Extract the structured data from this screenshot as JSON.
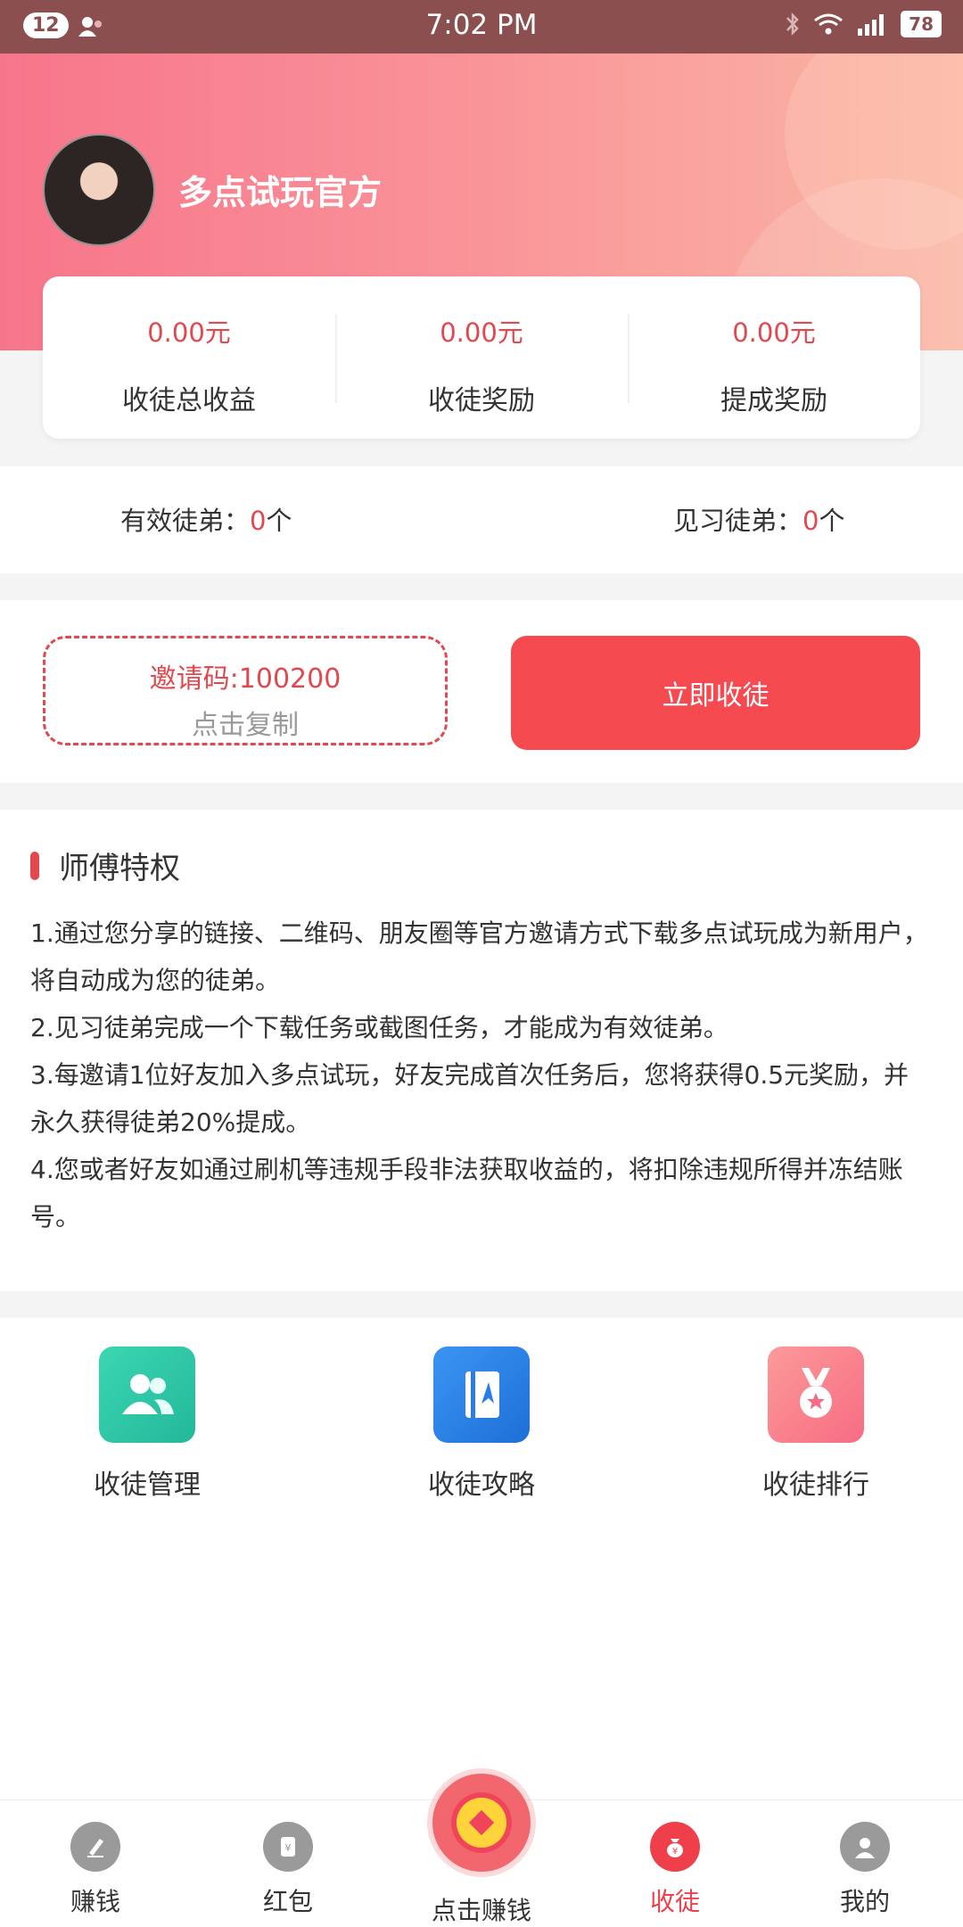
{
  "status_bar": {
    "notifications": "12",
    "time": "7:02 PM",
    "battery": "78"
  },
  "profile": {
    "username": "多点试玩官方"
  },
  "stats": [
    {
      "value": "0.00元",
      "label": "收徒总收益"
    },
    {
      "value": "0.00元",
      "label": "收徒奖励"
    },
    {
      "value": "0.00元",
      "label": "提成奖励"
    }
  ],
  "counts": {
    "valid_label": "有效徒弟：",
    "valid_count": "0",
    "valid_unit": "个",
    "trainee_label": "见习徒弟：",
    "trainee_count": "0",
    "trainee_unit": "个"
  },
  "invite": {
    "code_text": "邀请码:100200",
    "copy_text": "点击复制",
    "recruit_label": "立即收徒"
  },
  "privilege": {
    "title": "师傅特权",
    "rules": [
      "1.通过您分享的链接、二维码、朋友圈等官方邀请方式下载多点试玩成为新用户，将自动成为您的徒弟。",
      "2.见习徒弟完成一个下载任务或截图任务，才能成为有效徒弟。",
      "3.每邀请1位好友加入多点试玩，好友完成首次任务后，您将获得0.5元奖励，并永久获得徒弟20%提成。",
      "4.您或者好友如通过刷机等违规手段非法获取收益的，将扣除违规所得并冻结账号。"
    ]
  },
  "features": [
    {
      "label": "收徒管理",
      "icon": "users-icon",
      "color": "#2cc7a4"
    },
    {
      "label": "收徒攻略",
      "icon": "book-icon",
      "color": "#2a7de8"
    },
    {
      "label": "收徒排行",
      "icon": "medal-icon",
      "color": "#fb7c8a"
    }
  ],
  "nav": {
    "earn": "赚钱",
    "redpacket": "红包",
    "center": "点击赚钱",
    "recruit": "收徒",
    "mine": "我的"
  },
  "colors": {
    "accent": "#e2484e",
    "button": "#f44a50"
  }
}
